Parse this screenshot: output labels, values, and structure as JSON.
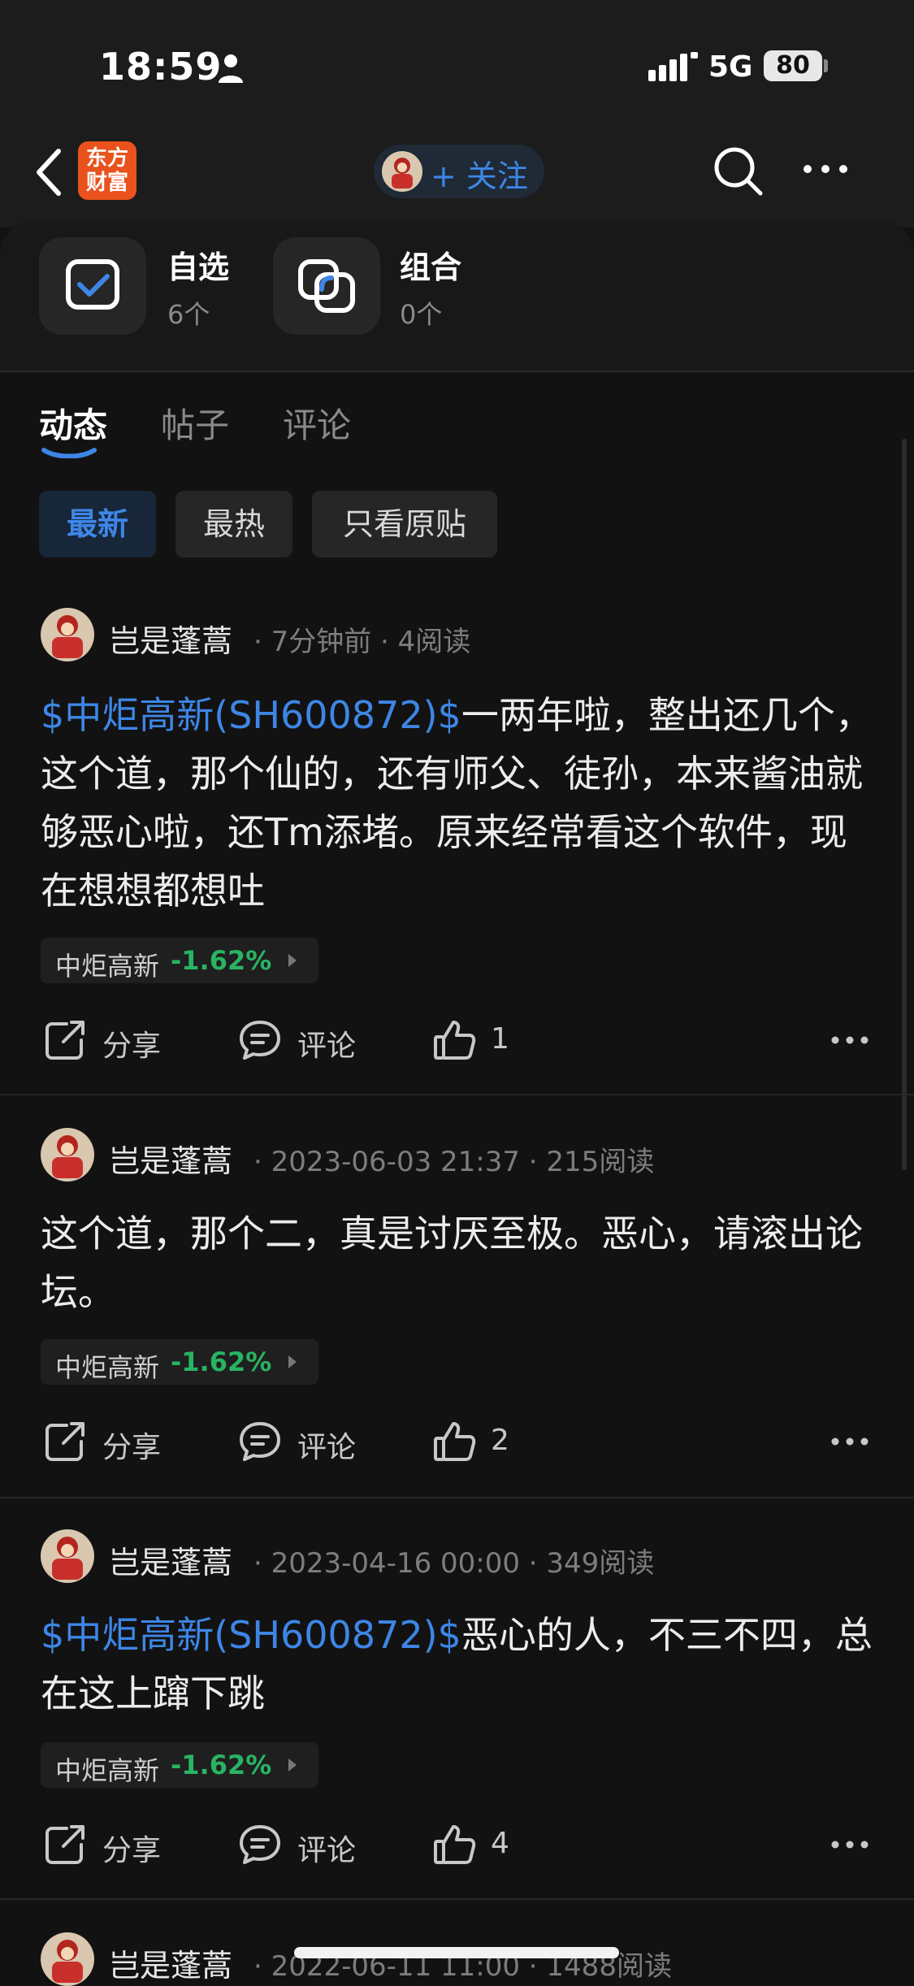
{
  "status_bar": {
    "time": "18:59",
    "network": "5G",
    "battery": "80"
  },
  "nav": {
    "logo_line1": "东方",
    "logo_line2": "财富",
    "follow_label": "+ 关注"
  },
  "shortcuts": [
    {
      "name": "自选",
      "count": "6个"
    },
    {
      "name": "组合",
      "count": "0个"
    }
  ],
  "tabs": [
    "动态",
    "帖子",
    "评论"
  ],
  "filters": [
    "最新",
    "最热",
    "只看原贴"
  ],
  "actions": {
    "share": "分享",
    "comment": "评论"
  },
  "posts": [
    {
      "author": "岂是蓬蒿",
      "meta": "· 7分钟前 · 4阅读",
      "stock_link": "$中炬高新(SH600872)$",
      "text": "一两年啦，整出还几个，这个道，那个仙的，还有师父、徒孙，本来酱油就够恶心啦，还Tm添堵。原来经常看这个软件，现在想想都想吐",
      "tag_name": "中炬高新",
      "tag_change": "-1.62%",
      "likes": "1"
    },
    {
      "author": "岂是蓬蒿",
      "meta": "· 2023-06-03 21:37 · 215阅读",
      "stock_link": "",
      "text": "这个道，那个二，真是讨厌至极。恶心，请滚出论坛。",
      "tag_name": "中炬高新",
      "tag_change": "-1.62%",
      "likes": "2"
    },
    {
      "author": "岂是蓬蒿",
      "meta": "· 2023-04-16 00:00 · 349阅读",
      "stock_link": "$中炬高新(SH600872)$",
      "text": "恶心的人，不三不四，总在这上蹿下跳",
      "tag_name": "中炬高新",
      "tag_change": "-1.62%",
      "likes": "4"
    },
    {
      "author": "岂是蓬蒿",
      "meta": "· 2022-06-11 11:00 · 1488阅读"
    }
  ],
  "colors": {
    "accent": "#3d86e6",
    "down": "#28b463",
    "background": "#121212",
    "brand": "#e9521c"
  }
}
